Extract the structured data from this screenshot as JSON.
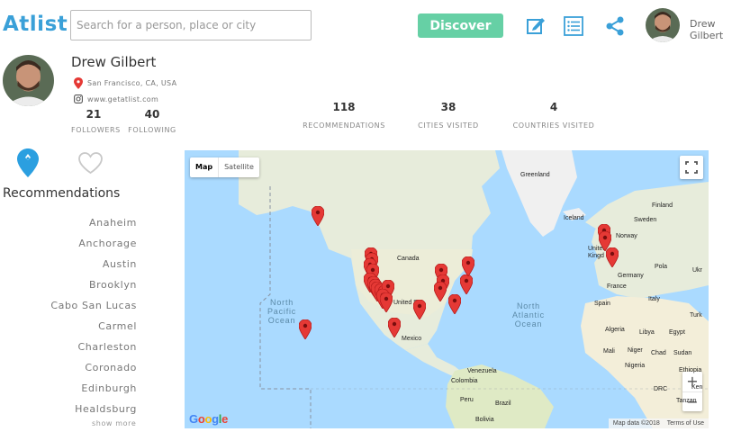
{
  "header": {
    "logo": "Atlist",
    "search_placeholder": "Search for a person, place or city",
    "discover_label": "Discover",
    "user_name": "Drew Gilbert",
    "icons": [
      "edit-icon",
      "list-icon",
      "share-icon"
    ],
    "accent_color": "#3aa0d8",
    "discover_color": "#66d0a5"
  },
  "profile": {
    "name": "Drew Gilbert",
    "location": "San Francisco, CA, USA",
    "website": "www.getatlist.com",
    "followers": {
      "value": "21",
      "label": "FOLLOWERS"
    },
    "following": {
      "value": "40",
      "label": "FOLLOWING"
    },
    "stats": [
      {
        "value": "118",
        "label": "RECOMMENDATIONS"
      },
      {
        "value": "38",
        "label": "CITIES VISITED"
      },
      {
        "value": "4",
        "label": "COUNTRIES VISITED"
      }
    ]
  },
  "recommendations": {
    "title": "Recommendations",
    "cities": [
      "Anaheim",
      "Anchorage",
      "Austin",
      "Brooklyn",
      "Cabo San Lucas",
      "Carmel",
      "Charleston",
      "Coronado",
      "Edinburgh",
      "Healdsburg"
    ],
    "show_more": "show more"
  },
  "map": {
    "map_label": "Map",
    "satellite_label": "Satellite",
    "google": "Google",
    "map_data": "Map data ©2018",
    "terms": "Terms of Use",
    "pin_color": "#e53935",
    "land_labels": {
      "greenland": "Greenland",
      "iceland": "Iceland",
      "finland": "Finland",
      "sweden": "Sweden",
      "norway": "Norway",
      "united": "United",
      "kingdom": "Kingd",
      "germany": "Germany",
      "poland": "Pola",
      "ukraine": "Ukr",
      "france": "France",
      "italy": "Italy",
      "spain": "Spain",
      "turkey": "Turk",
      "canada": "Canada",
      "united_states": "United Sta",
      "mexico": "Mexico",
      "venezuela": "Venezuela",
      "colombia": "Colombia",
      "peru": "Peru",
      "brazil": "Brazil",
      "bolivia": "Bolivia",
      "algeria": "Algeria",
      "libya": "Libya",
      "egypt": "Egypt",
      "mali": "Mali",
      "niger": "Niger",
      "chad": "Chad",
      "sudan": "Sudan",
      "nigeria": "Nigeria",
      "ethiopia": "Ethiopia",
      "drc": "DRC",
      "tanzania": "Tanzan",
      "kenya": "Ken"
    },
    "ocean_labels": {
      "north_pacific": "North\nPacific\nOcean",
      "north_atlantic": "North\nAtlantic\nOcean"
    }
  }
}
